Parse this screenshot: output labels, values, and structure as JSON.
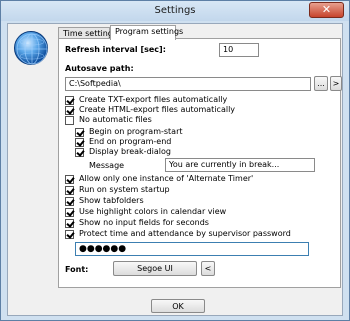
{
  "window": {
    "title": "Settings",
    "close_glyph": "✕"
  },
  "tabs": [
    {
      "label": "Time settings",
      "active": false
    },
    {
      "label": "Program settings",
      "active": true
    }
  ],
  "refresh": {
    "label": "Refresh interval [sec]:",
    "value": "10"
  },
  "autosave": {
    "label": "Autosave path:",
    "value": "C:\\Softpedia\\",
    "browse_label": "...",
    "go_label": ">"
  },
  "export_options": [
    {
      "label": "Create TXT-export files automatically",
      "checked": true
    },
    {
      "label": "Create HTML-export files automatically",
      "checked": true
    },
    {
      "label": "No automatic files",
      "checked": false
    }
  ],
  "program_options": [
    {
      "label": "Begin on program-start",
      "checked": true
    },
    {
      "label": "End on program-end",
      "checked": true
    },
    {
      "label": "Display break-dialog",
      "checked": true
    }
  ],
  "message": {
    "label": "Message",
    "value": "You are currently in break..."
  },
  "general_options": [
    {
      "label": "Allow only one instance of 'Alternate Timer'",
      "checked": true
    },
    {
      "label": "Run on system startup",
      "checked": true
    },
    {
      "label": "Show tabfolders",
      "checked": true
    },
    {
      "label": "Use highlight colors in calendar view",
      "checked": true
    },
    {
      "label": "Show no input fields for seconds",
      "checked": true
    },
    {
      "label": "Protect time and attendance by supervisor password",
      "checked": true
    }
  ],
  "password": {
    "value": "●●●●●●"
  },
  "font": {
    "label": "Font:",
    "value": "Segoe UI",
    "button_label": "<"
  },
  "ok_label": "OK",
  "icons": {
    "app": "globe-icon",
    "close": "close-icon",
    "check": "checkmark-icon"
  },
  "colors": {
    "frame": "#cfe0f0",
    "close": "#c7432b",
    "focus_border": "#3c7fb1"
  }
}
